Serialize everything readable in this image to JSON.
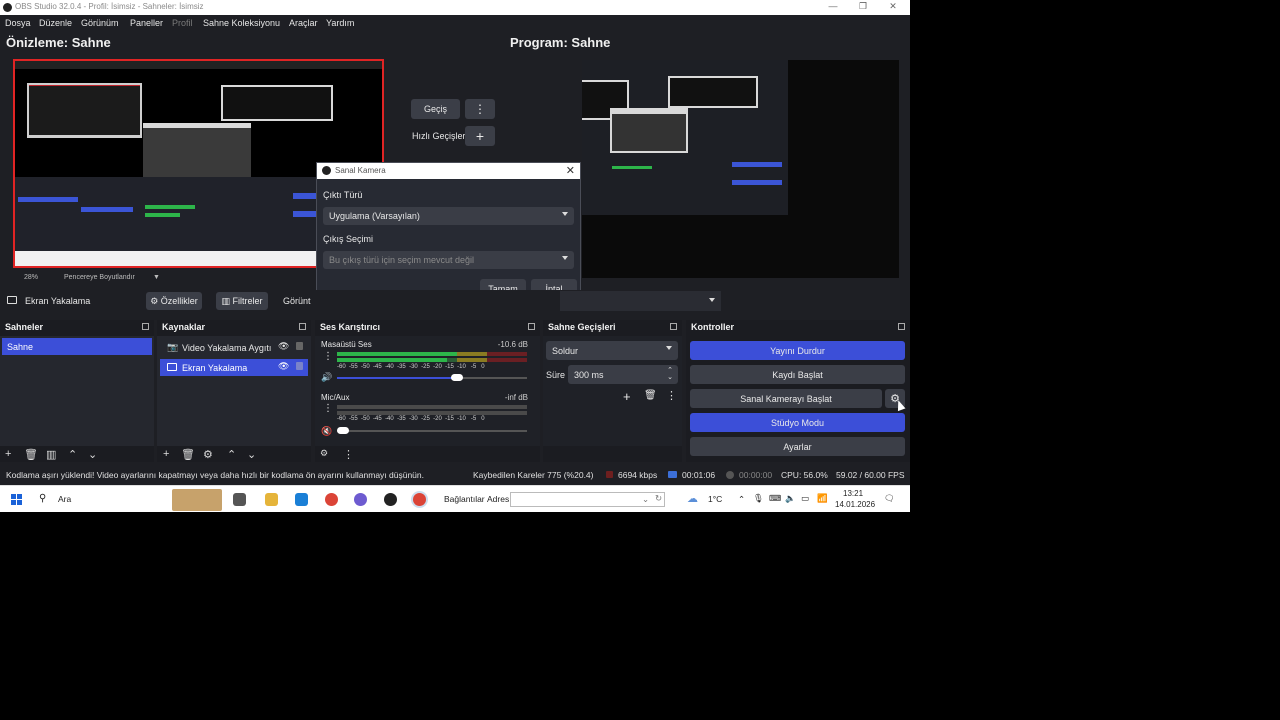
{
  "window": {
    "title": "OBS Studio 32.0.4 - Profil: İsimsiz - Sahneler: İsimsiz",
    "minimize": "—",
    "restore": "❐",
    "close": "✕"
  },
  "menu": [
    "Dosya",
    "Düzenle",
    "Görünüm",
    "Paneller",
    "Profil",
    "Sahne Koleksiyonu",
    "Araçlar",
    "Yardım"
  ],
  "preview": {
    "title": "Önizleme: Sahne",
    "zoom": "28%",
    "scale_mode": "Pencereye Boyutlandır"
  },
  "program": {
    "title": "Program: Sahne"
  },
  "transition_center": {
    "transition_label": "Geçiş",
    "quick_label": "Hızlı Geçişler"
  },
  "source_toolbar": {
    "source_name": "Ekran Yakalama",
    "properties": "Özellikler",
    "filters": "Filtreler",
    "display": "Görünt"
  },
  "dialog": {
    "title": "Sanal Kamera",
    "output_type_label": "Çıktı Türü",
    "output_type_value": "Uygulama (Varsayılan)",
    "output_selection_label": "Çıkış Seçimi",
    "output_selection_placeholder": "Bu çıkış türü için seçim mevcut değil",
    "ok": "Tamam",
    "cancel": "İptal"
  },
  "scenes": {
    "title": "Sahneler",
    "items": [
      "Sahne"
    ]
  },
  "sources": {
    "title": "Kaynaklar",
    "items": [
      "Video Yakalama Aygıtı",
      "Ekran Yakalama"
    ]
  },
  "mixer": {
    "title": "Ses Karıştırıcı",
    "channels": [
      {
        "name": "Masaüstü Ses",
        "level": "-10.6 dB"
      },
      {
        "name": "Mic/Aux",
        "level": "-inf dB"
      }
    ],
    "ticks": [
      "-60",
      "-55",
      "-50",
      "-45",
      "-40",
      "-35",
      "-30",
      "-25",
      "-20",
      "-15",
      "-10",
      "-5",
      "0"
    ]
  },
  "transitions": {
    "title": "Sahne Geçişleri",
    "type": "Soldur",
    "duration_label": "Süre",
    "duration_value": "300 ms"
  },
  "controls": {
    "title": "Kontroller",
    "stop_stream": "Yayını Durdur",
    "start_record": "Kaydı Başlat",
    "start_virtualcam": "Sanal Kamerayı Başlat",
    "studio_mode": "Stüdyo Modu",
    "settings": "Ayarlar"
  },
  "status": {
    "warning": "Kodlama aşırı yüklendi! Video ayarlarını kapatmayı veya daha hızlı bir kodlama ön ayarını kullanmayı düşünün.",
    "dropped": "Kaybedilen Kareler 775 (%20.4)",
    "bitrate": "6694 kbps",
    "stream_time": "00:01:06",
    "record_time": "00:00:00",
    "cpu": "CPU: 56.0%",
    "fps": "59.02 / 60.00 FPS"
  },
  "taskbar": {
    "search": "Ara",
    "links": "Bağlantılar",
    "address_label": "Adres",
    "temperature": "1°C",
    "time": "13:21",
    "date": "14.01.2026"
  },
  "colors": {
    "accent": "#3c4fd8",
    "preview_border": "#e02424",
    "meter_green": "#2db54a",
    "meter_yellow": "#c9b32a",
    "meter_red": "#c0232b"
  }
}
